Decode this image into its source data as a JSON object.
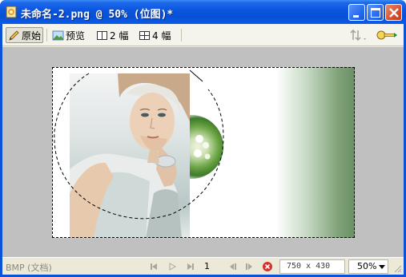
{
  "window": {
    "title": "未命名-2.png @  50% (位图)*"
  },
  "toolbar": {
    "original_label": "原始",
    "preview_label": "预览",
    "two_up_label": "2 幅",
    "four_up_label": "4 幅"
  },
  "status": {
    "doc_type": "BMP (文档)",
    "page": "1",
    "dimensions": "750 x 430",
    "zoom": "50%"
  },
  "colors": {
    "title_bar": "#0a55df",
    "close_button": "#d8502e",
    "canvas_bg": "#c0c0c0",
    "gradient_green": "#6b9066"
  }
}
